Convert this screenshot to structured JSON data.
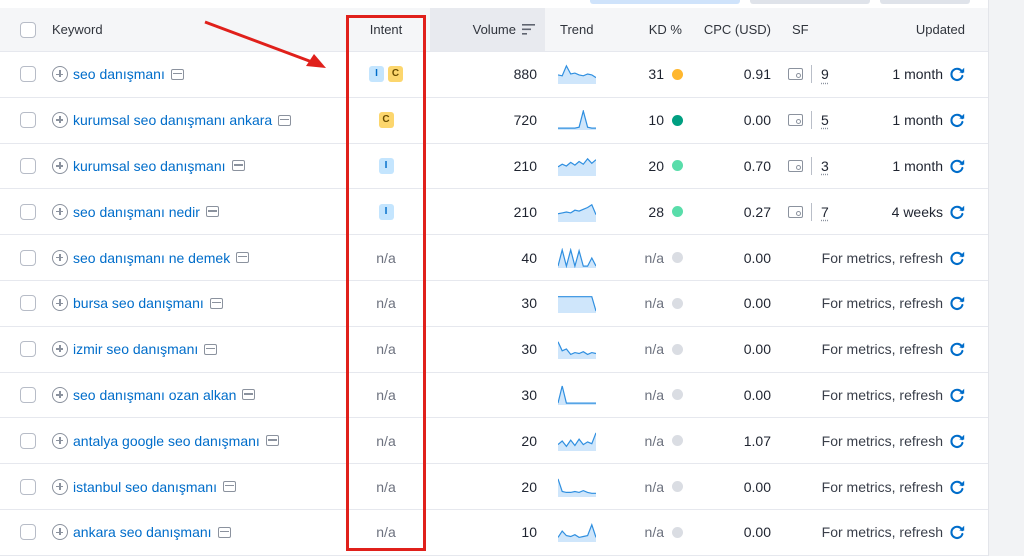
{
  "header": {
    "keyword": "Keyword",
    "intent": "Intent",
    "volume": "Volume",
    "trend": "Trend",
    "kd": "KD %",
    "cpc": "CPC (USD)",
    "sf": "SF",
    "updated": "Updated"
  },
  "colors": {
    "link": "#006dca",
    "kd_orange": "#ffb72e",
    "kd_green_dark": "#009f81",
    "kd_green": "#59ddaa",
    "kd_gray": "#dadde3",
    "refresh": "#006dca",
    "annotation_red": "#e0201b"
  },
  "rows": [
    {
      "keyword": "seo danışmanı",
      "intent": [
        "I",
        "C"
      ],
      "intent_text": "",
      "volume": "880",
      "trend": [
        0.45,
        0.4,
        0.95,
        0.5,
        0.55,
        0.45,
        0.4,
        0.5,
        0.45,
        0.3
      ],
      "kd": "31",
      "kd_color": "#ffb72e",
      "cpc": "0.91",
      "sf_count": "9",
      "updated": "1 month"
    },
    {
      "keyword": "kurumsal seo danışmanı ankara",
      "intent": [
        "C"
      ],
      "intent_text": "",
      "volume": "720",
      "trend": [
        0.05,
        0.05,
        0.05,
        0.05,
        0.05,
        0.1,
        1.0,
        0.1,
        0.05,
        0.05
      ],
      "kd": "10",
      "kd_color": "#009f81",
      "cpc": "0.00",
      "sf_count": "5",
      "updated": "1 month"
    },
    {
      "keyword": "kurumsal seo danışmanı",
      "intent": [
        "I"
      ],
      "intent_text": "",
      "volume": "210",
      "trend": [
        0.45,
        0.6,
        0.5,
        0.7,
        0.55,
        0.75,
        0.6,
        0.9,
        0.65,
        0.85
      ],
      "kd": "20",
      "kd_color": "#59ddaa",
      "cpc": "0.70",
      "sf_count": "3",
      "updated": "1 month"
    },
    {
      "keyword": "seo danışmanı nedir",
      "intent": [
        "I"
      ],
      "intent_text": "",
      "volume": "210",
      "trend": [
        0.4,
        0.45,
        0.5,
        0.45,
        0.6,
        0.55,
        0.65,
        0.75,
        0.9,
        0.35
      ],
      "kd": "28",
      "kd_color": "#59ddaa",
      "cpc": "0.27",
      "sf_count": "7",
      "updated": "4 weeks"
    },
    {
      "keyword": "seo danışmanı ne demek",
      "intent": [],
      "intent_text": "n/a",
      "volume": "40",
      "trend": [
        0.05,
        0.95,
        0.05,
        0.95,
        0.05,
        0.9,
        0.05,
        0.05,
        0.5,
        0.05
      ],
      "kd": "n/a",
      "kd_color": "#dadde3",
      "cpc": "0.00",
      "sf_count": "",
      "updated": "For metrics, refresh"
    },
    {
      "keyword": "bursa seo danışmanı",
      "intent": [],
      "intent_text": "n/a",
      "volume": "30",
      "trend": [
        0.85,
        0.85,
        0.85,
        0.85,
        0.85,
        0.85,
        0.85,
        0.85,
        0.85,
        0.05
      ],
      "kd": "n/a",
      "kd_color": "#dadde3",
      "cpc": "0.00",
      "sf_count": "",
      "updated": "For metrics, refresh"
    },
    {
      "keyword": "izmir seo danışmanı",
      "intent": [],
      "intent_text": "n/a",
      "volume": "30",
      "trend": [
        0.9,
        0.4,
        0.5,
        0.2,
        0.3,
        0.25,
        0.35,
        0.2,
        0.3,
        0.25
      ],
      "kd": "n/a",
      "kd_color": "#dadde3",
      "cpc": "0.00",
      "sf_count": "",
      "updated": "For metrics, refresh"
    },
    {
      "keyword": "seo danışmanı ozan alkan",
      "intent": [],
      "intent_text": "n/a",
      "volume": "30",
      "trend": [
        0.05,
        1.0,
        0.05,
        0.05,
        0.05,
        0.05,
        0.05,
        0.05,
        0.05,
        0.05
      ],
      "kd": "n/a",
      "kd_color": "#dadde3",
      "cpc": "0.00",
      "sf_count": "",
      "updated": "For metrics, refresh"
    },
    {
      "keyword": "antalya google seo danışmanı",
      "intent": [],
      "intent_text": "n/a",
      "volume": "20",
      "trend": [
        0.3,
        0.5,
        0.2,
        0.55,
        0.25,
        0.6,
        0.3,
        0.45,
        0.35,
        0.95
      ],
      "kd": "n/a",
      "kd_color": "#dadde3",
      "cpc": "1.07",
      "sf_count": "",
      "updated": "For metrics, refresh"
    },
    {
      "keyword": "istanbul seo danışmanı",
      "intent": [],
      "intent_text": "n/a",
      "volume": "20",
      "trend": [
        0.95,
        0.25,
        0.2,
        0.2,
        0.25,
        0.2,
        0.3,
        0.2,
        0.15,
        0.15
      ],
      "kd": "n/a",
      "kd_color": "#dadde3",
      "cpc": "0.00",
      "sf_count": "",
      "updated": "For metrics, refresh"
    },
    {
      "keyword": "ankara seo danışmanı",
      "intent": [],
      "intent_text": "n/a",
      "volume": "10",
      "trend": [
        0.2,
        0.55,
        0.3,
        0.25,
        0.35,
        0.2,
        0.25,
        0.3,
        0.9,
        0.2
      ],
      "kd": "n/a",
      "kd_color": "#dadde3",
      "cpc": "0.00",
      "sf_count": "",
      "updated": "For metrics, refresh"
    }
  ]
}
